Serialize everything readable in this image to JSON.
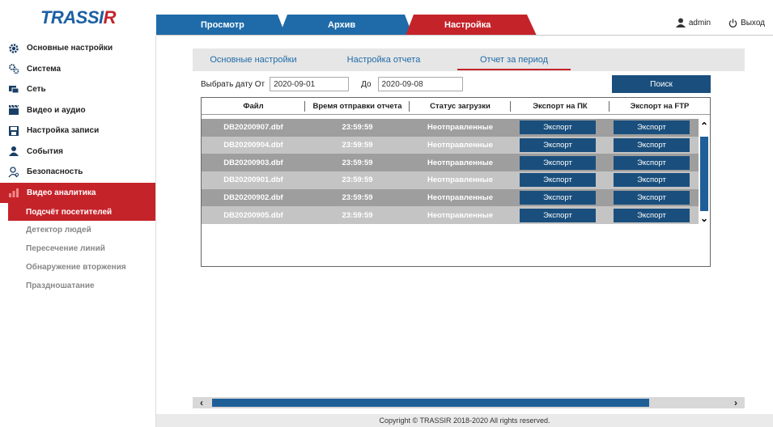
{
  "app": {
    "logo_main": "TRASSI",
    "logo_accent": "R"
  },
  "top_tabs": [
    "Просмотр",
    "Архив",
    "Настройка"
  ],
  "user": {
    "name": "admin",
    "logout": "Выход"
  },
  "sidebar": {
    "items": [
      {
        "label": "Основные настройки",
        "icon": "gear-icon"
      },
      {
        "label": "Система",
        "icon": "gears-icon"
      },
      {
        "label": "Сеть",
        "icon": "network-icon"
      },
      {
        "label": "Видео и аудио",
        "icon": "clapper-icon"
      },
      {
        "label": "Настройка записи",
        "icon": "save-icon"
      },
      {
        "label": "События",
        "icon": "user-event-icon"
      },
      {
        "label": "Безопасность",
        "icon": "user-security-icon"
      },
      {
        "label": "Видео аналитика",
        "icon": "analytics-icon"
      }
    ],
    "subitems": [
      "Подсчёт посетителей",
      "Детектор людей",
      "Пересечение линий",
      "Обнаружение вторжения",
      "Праздношатание"
    ]
  },
  "subtabs": [
    "Основные настройки",
    "Настройка отчета",
    "Отчет за период"
  ],
  "filter": {
    "from_label": "Выбрать дату От",
    "from_value": "2020-09-01",
    "to_label": "До",
    "to_value": "2020-09-08",
    "search": "Поиск"
  },
  "table": {
    "headers": [
      "Файл",
      "Время отправки отчета",
      "Статус загрузки",
      "Экспорт на ПК",
      "Экспорт на FTP"
    ],
    "rows": [
      {
        "file": "DB20200907.dbf",
        "time": "23:59:59",
        "status": "Неотправленные",
        "pc": "Экспорт",
        "ftp": "Экспорт"
      },
      {
        "file": "DB20200904.dbf",
        "time": "23:59:59",
        "status": "Неотправленные",
        "pc": "Экспорт",
        "ftp": "Экспорт"
      },
      {
        "file": "DB20200903.dbf",
        "time": "23:59:59",
        "status": "Неотправленные",
        "pc": "Экспорт",
        "ftp": "Экспорт"
      },
      {
        "file": "DB20200901.dbf",
        "time": "23:59:59",
        "status": "Неотправленные",
        "pc": "Экспорт",
        "ftp": "Экспорт"
      },
      {
        "file": "DB20200902.dbf",
        "time": "23:59:59",
        "status": "Неотправленные",
        "pc": "Экспорт",
        "ftp": "Экспорт"
      },
      {
        "file": "DB20200905.dbf",
        "time": "23:59:59",
        "status": "Неотправленные",
        "pc": "Экспорт",
        "ftp": "Экспорт"
      }
    ]
  },
  "colors": {
    "brand_blue": "#1f6ba9",
    "accent_red": "#c5232a",
    "button_dark": "#1a4f7d"
  },
  "footer": "Copyright © TRASSIR 2018-2020 All rights reserved."
}
